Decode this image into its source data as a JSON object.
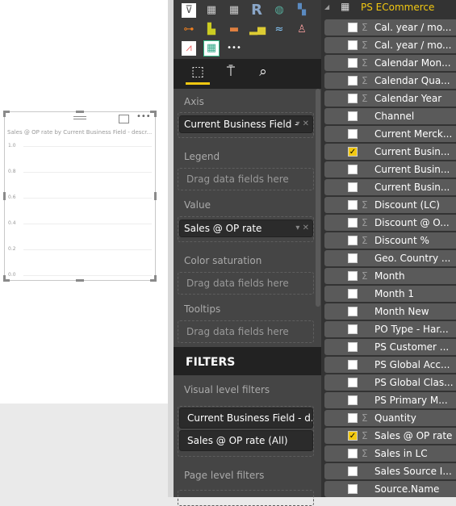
{
  "visual": {
    "title": "Sales @ OP rate by Current Business Field - descr...",
    "icons": [
      "focus-mode-icon",
      "more-options-icon"
    ]
  },
  "chart_data": {
    "type": "bar",
    "title": "Sales @ OP rate by Current Business Field - descr...",
    "categories": [],
    "values": [],
    "ylim": [
      0,
      1
    ],
    "yticks": [
      "1.0",
      "0.8",
      "0.6",
      "0.4",
      "0.2",
      "0.0"
    ],
    "grid": true
  },
  "viz_pane": {
    "tabs": [
      "fields-tab",
      "format-tab",
      "analytics-tab"
    ],
    "axis_label": "Axis",
    "axis_field": "Current Business Field -",
    "legend_label": "Legend",
    "drag_text": "Drag data fields here",
    "value_label": "Value",
    "value_field": "Sales @ OP rate",
    "color_label": "Color saturation",
    "tooltips_label": "Tooltips",
    "filters_title": "FILTERS",
    "visual_filters_label": "Visual level filters",
    "visual_filters": [
      "Current Business Field - d...",
      "Sales @ OP rate  (All)"
    ],
    "page_filters_label": "Page level filters"
  },
  "fields_pane": {
    "table": "PS ECommerce",
    "accent": "#f2c811",
    "fields": [
      {
        "name": "Cal. year / mo...",
        "sigma": true,
        "checked": false
      },
      {
        "name": "Cal. year / mo...",
        "sigma": true,
        "checked": false
      },
      {
        "name": "Calendar Mon...",
        "sigma": true,
        "checked": false
      },
      {
        "name": "Calendar Qua...",
        "sigma": true,
        "checked": false
      },
      {
        "name": "Calendar Year",
        "sigma": true,
        "checked": false
      },
      {
        "name": "Channel",
        "sigma": false,
        "checked": false
      },
      {
        "name": "Current Merck...",
        "sigma": false,
        "checked": false
      },
      {
        "name": "Current Busin...",
        "sigma": false,
        "checked": true
      },
      {
        "name": "Current Busin...",
        "sigma": false,
        "checked": false
      },
      {
        "name": "Current Busin...",
        "sigma": false,
        "checked": false
      },
      {
        "name": "Discount (LC)",
        "sigma": true,
        "checked": false
      },
      {
        "name": "Discount @ O...",
        "sigma": true,
        "checked": false
      },
      {
        "name": "Discount %",
        "sigma": true,
        "checked": false
      },
      {
        "name": "Geo. Country ...",
        "sigma": false,
        "checked": false
      },
      {
        "name": "Month",
        "sigma": true,
        "checked": false
      },
      {
        "name": "Month 1",
        "sigma": false,
        "checked": false
      },
      {
        "name": "Month New",
        "sigma": false,
        "checked": false
      },
      {
        "name": "PO Type - Har...",
        "sigma": false,
        "checked": false
      },
      {
        "name": "PS Customer ...",
        "sigma": false,
        "checked": false
      },
      {
        "name": "PS Global Acc...",
        "sigma": false,
        "checked": false
      },
      {
        "name": "PS Global Clas...",
        "sigma": false,
        "checked": false
      },
      {
        "name": "PS Primary M...",
        "sigma": false,
        "checked": false
      },
      {
        "name": "Quantity",
        "sigma": true,
        "checked": false
      },
      {
        "name": "Sales @ OP rate",
        "sigma": true,
        "checked": true
      },
      {
        "name": "Sales in LC",
        "sigma": true,
        "checked": false
      },
      {
        "name": "Sales Source I...",
        "sigma": false,
        "checked": false
      },
      {
        "name": "Source.Name",
        "sigma": false,
        "checked": false
      }
    ]
  }
}
